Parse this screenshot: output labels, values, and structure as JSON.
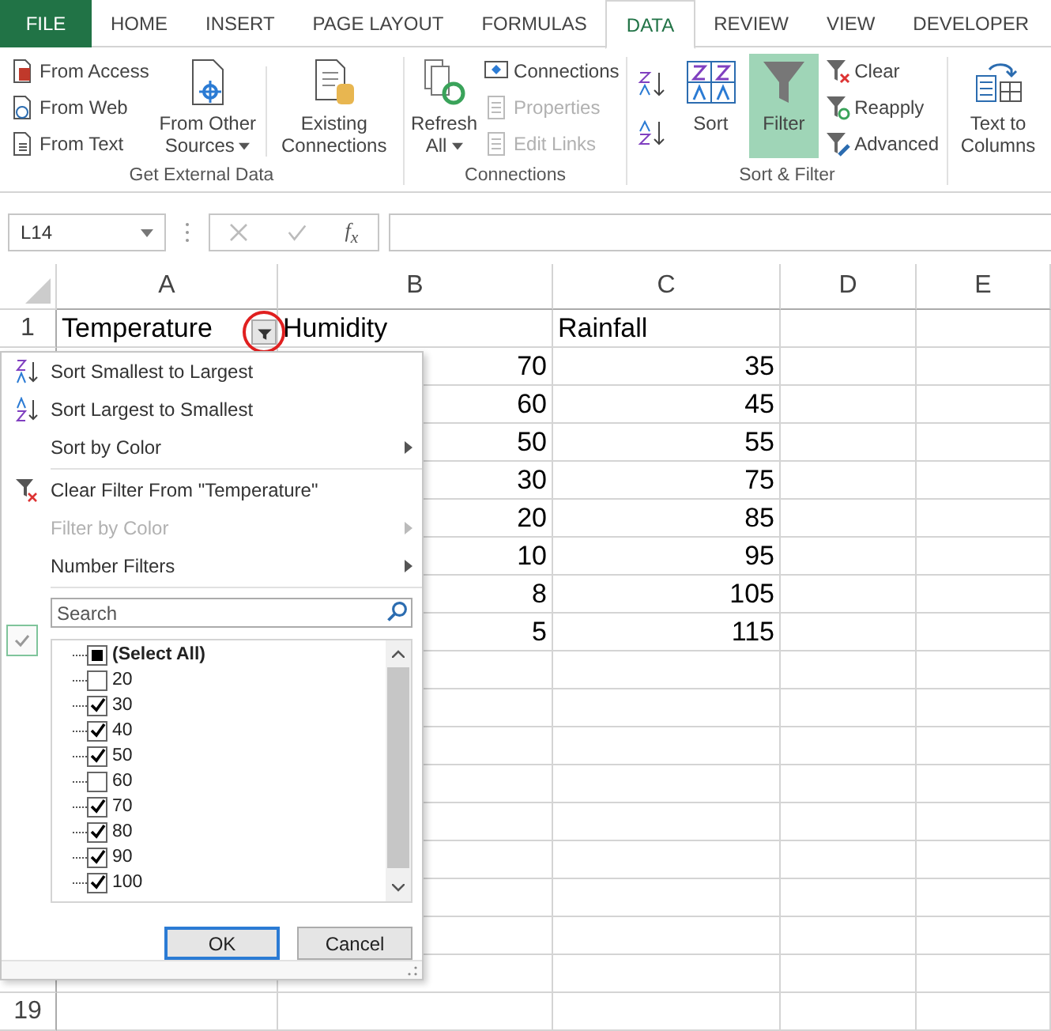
{
  "tabs": [
    {
      "label": "FILE",
      "kind": "file",
      "selected": false
    },
    {
      "label": "HOME",
      "kind": "tab",
      "selected": false
    },
    {
      "label": "INSERT",
      "kind": "tab",
      "selected": false
    },
    {
      "label": "PAGE LAYOUT",
      "kind": "tab",
      "selected": false
    },
    {
      "label": "FORMULAS",
      "kind": "tab",
      "selected": false
    },
    {
      "label": "DATA",
      "kind": "tab",
      "selected": true
    },
    {
      "label": "REVIEW",
      "kind": "tab",
      "selected": false
    },
    {
      "label": "VIEW",
      "kind": "tab",
      "selected": false
    },
    {
      "label": "DEVELOPER",
      "kind": "tab",
      "selected": false
    }
  ],
  "ribbon": {
    "groups": [
      {
        "label": "Get External Data",
        "buttons": [
          {
            "label": "From Access",
            "disabled": false
          },
          {
            "label": "From Web",
            "disabled": false
          },
          {
            "label": "From Text",
            "disabled": false
          },
          {
            "label": "From Other Sources",
            "disabled": false,
            "dropdown": true
          },
          {
            "label": "Existing Connections",
            "disabled": false
          }
        ]
      },
      {
        "label": "Connections",
        "buttons": [
          {
            "label": "Refresh All",
            "disabled": false,
            "dropdown": true
          },
          {
            "label": "Connections",
            "disabled": false
          },
          {
            "label": "Properties",
            "disabled": true
          },
          {
            "label": "Edit Links",
            "disabled": true
          }
        ]
      },
      {
        "label": "Sort & Filter",
        "buttons": [
          {
            "label": "Sort",
            "disabled": false,
            "selected": false
          },
          {
            "label": "Filter",
            "disabled": false,
            "selected": true
          },
          {
            "label": "Clear",
            "disabled": false
          },
          {
            "label": "Reapply",
            "disabled": false
          },
          {
            "label": "Advanced",
            "disabled": false
          }
        ]
      },
      {
        "buttons": [
          {
            "label": "Text to Columns",
            "disabled": false
          }
        ]
      }
    ]
  },
  "formula_bar": {
    "name_box": "L14",
    "function_label": "f$_{x}$"
  },
  "columns": [
    "A",
    "B",
    "C",
    "D",
    "E"
  ],
  "rows": [
    {
      "number": "1",
      "a": "Temperature",
      "b": "Humidity",
      "c": "Rainfall"
    },
    {
      "b": "70",
      "c": "35"
    },
    {
      "b": "60",
      "c": "45"
    },
    {
      "b": "50",
      "c": "55"
    },
    {
      "b": "30",
      "c": "75"
    },
    {
      "b": "20",
      "c": "85"
    },
    {
      "b": "10",
      "c": "95"
    },
    {
      "b": "8",
      "c": "105"
    },
    {
      "b": "5",
      "c": "115"
    },
    {},
    {},
    {},
    {},
    {},
    {},
    {},
    {},
    {},
    {
      "number": "19"
    }
  ],
  "filter_menu": {
    "items": [
      {
        "kind": "item",
        "label": "Sort Smallest to Largest",
        "disabled": false,
        "submenu": false
      },
      {
        "kind": "item",
        "label": "Sort Largest to Smallest",
        "disabled": false,
        "submenu": false
      },
      {
        "kind": "item",
        "label": "Sort by Color",
        "disabled": false,
        "submenu": true
      },
      {
        "kind": "separator"
      },
      {
        "kind": "item",
        "label": "Clear Filter From \"Temperature\"",
        "disabled": false,
        "submenu": false
      },
      {
        "kind": "item",
        "label": "Filter by Color",
        "disabled": true,
        "submenu": true
      },
      {
        "kind": "item",
        "label": "Number Filters",
        "disabled": false,
        "submenu": true
      },
      {
        "kind": "separator"
      }
    ],
    "search": {
      "placeholder": "Search"
    },
    "values": [
      {
        "label": "(Select All)",
        "checked": true,
        "partial": true
      },
      {
        "label": "20",
        "checked": false
      },
      {
        "label": "30",
        "checked": true
      },
      {
        "label": "40",
        "checked": true
      },
      {
        "label": "50",
        "checked": true
      },
      {
        "label": "60",
        "checked": false
      },
      {
        "label": "70",
        "checked": true
      },
      {
        "label": "80",
        "checked": true
      },
      {
        "label": "90",
        "checked": true
      },
      {
        "label": "100",
        "checked": true
      }
    ],
    "buttons": [
      {
        "label": "OK",
        "selected": true
      },
      {
        "label": "Cancel",
        "selected": false
      }
    ]
  }
}
